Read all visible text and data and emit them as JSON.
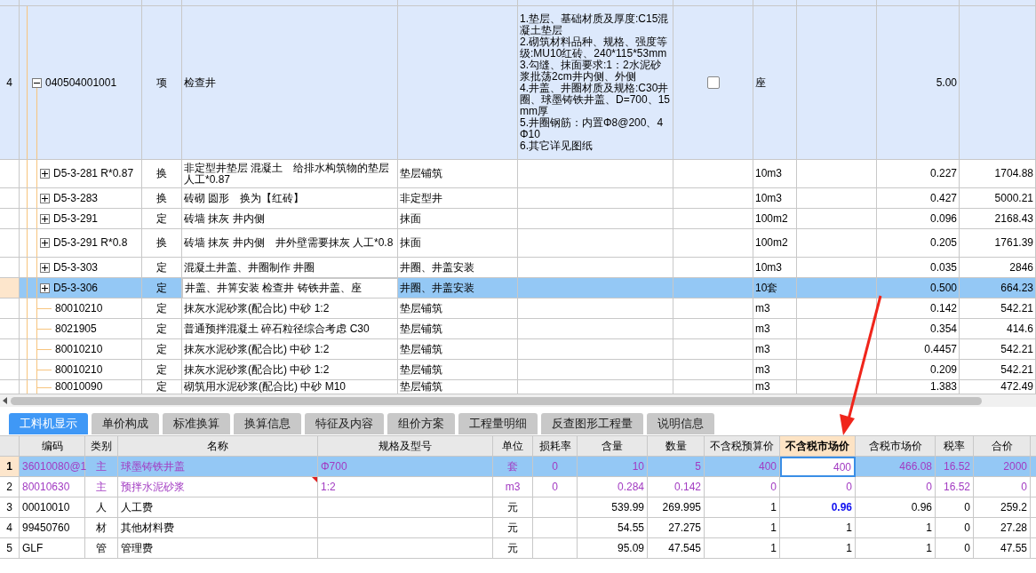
{
  "upper_grid": {
    "rows": [
      {
        "kind": "item",
        "row_number": "4",
        "code": "040504001001",
        "expanded": true,
        "selected": false,
        "category": "项",
        "name": "检查井",
        "features": [
          "1.垫层、基础材质及厚度:C15混凝土垫层",
          "2.砌筑材料品种、规格、强度等级:MU10红砖、240*115*53mm",
          "3.勾缝、抹面要求:1：2水泥砂浆批荡2cm井内侧、外侧",
          "4.井盖、井圈材质及规格:C30井圈、球墨铸铁井盖、D=700、15mm厚",
          "5.井圈钢筋：内置Φ8@200、4Φ10",
          "6.其它详见图纸"
        ],
        "checked": false,
        "unit": "座",
        "column_10": "5.00"
      },
      {
        "kind": "quota",
        "code": "D5-3-281 R*0.87",
        "expanded": false,
        "selected": false,
        "category": "换",
        "name": "非定型井垫层 混凝土　给排水构筑物的垫层人工*0.87",
        "column_4": "垫层铺筑",
        "unit": "10m3",
        "column_10": "0.227",
        "column_11": "1704.88"
      },
      {
        "kind": "quota",
        "code": "D5-3-283",
        "expanded": false,
        "selected": false,
        "category": "换",
        "name": "砖砌 圆形　换为【红砖】",
        "column_4": "非定型井",
        "unit": "10m3",
        "column_10": "0.427",
        "column_11": "5000.21"
      },
      {
        "kind": "quota",
        "code": "D5-3-291",
        "expanded": false,
        "selected": false,
        "category": "定",
        "name": "砖墙 抹灰 井内侧",
        "column_4": "抹面",
        "unit": "100m2",
        "column_10": "0.096",
        "column_11": "2168.43"
      },
      {
        "kind": "quota",
        "code": "D5-3-291 R*0.8",
        "expanded": false,
        "selected": false,
        "category": "换",
        "name": "砖墙 抹灰 井内侧　井外壁需要抹灰 人工*0.8",
        "column_4": "抹面",
        "unit": "100m2",
        "column_10": "0.205",
        "column_11": "1761.39"
      },
      {
        "kind": "quota",
        "code": "D5-3-303",
        "expanded": false,
        "selected": false,
        "category": "定",
        "name": "混凝土井盖、井圈制作 井圈",
        "column_4": "井圈、井盖安装",
        "unit": "10m3",
        "column_10": "0.035",
        "column_11": "2846"
      },
      {
        "kind": "quota",
        "code": "D5-3-306",
        "expanded": false,
        "selected": true,
        "category": "定",
        "name": "井盖、井箅安装 检查井 铸铁井盖、座",
        "column_4": "井圈、井盖安装",
        "unit": "10套",
        "column_10": "0.500",
        "column_11": "664.23"
      },
      {
        "kind": "material",
        "code": "80010210",
        "selected": false,
        "category": "定",
        "name": "抹灰水泥砂浆(配合比) 中砂 1:2",
        "column_4": "垫层铺筑",
        "unit": "m3",
        "column_10": "0.142",
        "column_11": "542.21"
      },
      {
        "kind": "material",
        "code": "8021905",
        "selected": false,
        "category": "定",
        "name": "普通预拌混凝土 碎石粒径综合考虑 C30",
        "column_4": "垫层铺筑",
        "unit": "m3",
        "column_10": "0.354",
        "column_11": "414.6"
      },
      {
        "kind": "material",
        "code": "80010210",
        "selected": false,
        "category": "定",
        "name": "抹灰水泥砂浆(配合比) 中砂 1:2",
        "column_4": "垫层铺筑",
        "unit": "m3",
        "column_10": "0.4457",
        "column_11": "542.21"
      },
      {
        "kind": "material",
        "code": "80010210",
        "selected": false,
        "category": "定",
        "name": "抹灰水泥砂浆(配合比) 中砂 1:2",
        "column_4": "垫层铺筑",
        "unit": "m3",
        "column_10": "0.209",
        "column_11": "542.21"
      },
      {
        "kind": "material",
        "code": "80010090",
        "selected": false,
        "category": "定",
        "name": "砌筑用水泥砂浆(配合比) 中砂 M10",
        "column_4": "垫层铺筑",
        "unit": "m3",
        "column_10": "1.383",
        "column_11": "472.49"
      }
    ]
  },
  "tabs": [
    {
      "label": "工料机显示",
      "selected": true
    },
    {
      "label": "单价构成",
      "selected": false
    },
    {
      "label": "标准换算",
      "selected": false
    },
    {
      "label": "换算信息",
      "selected": false
    },
    {
      "label": "特征及内容",
      "selected": false
    },
    {
      "label": "组价方案",
      "selected": false
    },
    {
      "label": "工程量明细",
      "selected": false
    },
    {
      "label": "反查图形工程量",
      "selected": false
    },
    {
      "label": "说明信息",
      "selected": false
    }
  ],
  "resource_table": {
    "columns": [
      {
        "label": "编码",
        "active": false
      },
      {
        "label": "类别",
        "active": false
      },
      {
        "label": "名称",
        "active": false
      },
      {
        "label": "规格及型号",
        "active": false
      },
      {
        "label": "单位",
        "active": false
      },
      {
        "label": "损耗率",
        "active": false
      },
      {
        "label": "含量",
        "active": false
      },
      {
        "label": "数量",
        "active": false
      },
      {
        "label": "不含税预算价",
        "active": false
      },
      {
        "label": "不含税市场价",
        "active": true
      },
      {
        "label": "含税市场价",
        "active": false
      },
      {
        "label": "税率",
        "active": false
      },
      {
        "label": "合价",
        "active": false
      }
    ],
    "rows": [
      {
        "row_number": "1",
        "kind": "main",
        "selected": true,
        "flagged": false,
        "highlighted": false,
        "code": "36010080@1",
        "category": "主",
        "name": "球墨铸铁井盖",
        "spec": "Φ700",
        "unit": "套",
        "loss_rate": "0",
        "content": "10",
        "amount": "5",
        "budget_price": "400",
        "market_price": "400",
        "tax_market_price": "466.08",
        "tax_rate": "16.52",
        "total": "2000"
      },
      {
        "row_number": "2",
        "kind": "main",
        "selected": false,
        "flagged": true,
        "highlighted": false,
        "code": "80010630",
        "category": "主",
        "name": "预拌水泥砂浆",
        "spec": "1:2",
        "unit": "m3",
        "loss_rate": "0",
        "content": "0.284",
        "amount": "0.142",
        "budget_price": "0",
        "market_price": "0",
        "tax_market_price": "0",
        "tax_rate": "16.52",
        "total": "0"
      },
      {
        "row_number": "3",
        "kind": "other",
        "selected": false,
        "flagged": false,
        "highlighted": true,
        "code": "00010010",
        "category": "人",
        "name": "人工费",
        "unit": "元",
        "content": "539.99",
        "amount": "269.995",
        "budget_price": "1",
        "market_price": "0.96",
        "tax_market_price": "0.96",
        "tax_rate": "0",
        "total": "259.2"
      },
      {
        "row_number": "4",
        "kind": "other",
        "selected": false,
        "flagged": false,
        "highlighted": false,
        "code": "99450760",
        "category": "材",
        "name": "其他材料费",
        "unit": "元",
        "content": "54.55",
        "amount": "27.275",
        "budget_price": "1",
        "market_price": "1",
        "tax_market_price": "1",
        "tax_rate": "0",
        "total": "27.28"
      },
      {
        "row_number": "5",
        "kind": "other",
        "selected": false,
        "flagged": false,
        "highlighted": false,
        "code": "GLF",
        "category": "管",
        "name": "管理费",
        "unit": "元",
        "content": "95.09",
        "amount": "47.545",
        "budget_price": "1",
        "market_price": "1",
        "tax_market_price": "1",
        "tax_rate": "0",
        "total": "47.55"
      }
    ]
  }
}
